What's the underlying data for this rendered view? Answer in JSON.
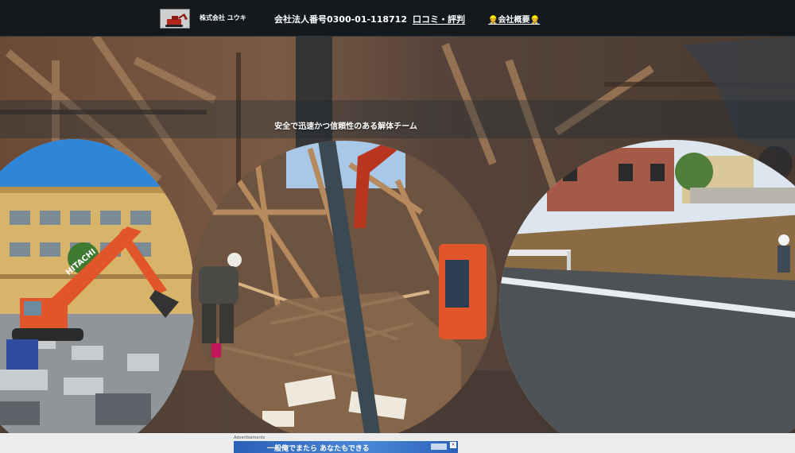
{
  "header": {
    "company_name": "株式会社 ユウキ",
    "registration": "会社法人番号0300-01-118712",
    "nav_reviews": "口コミ・評判",
    "nav_company": "👷会社概要👷"
  },
  "hero": {
    "tagline": "安全で迅速かつ信頼性のある解体チーム",
    "machine_label": "HITACHI"
  },
  "ad": {
    "label": "Advertisements",
    "banner_text": "一般俺でまたら あなたもできる",
    "close_glyph": "×"
  },
  "colors": {
    "header_bg": "#13191d",
    "excavator_orange": "#e0552a",
    "sky_blue": "#2f86d6"
  }
}
